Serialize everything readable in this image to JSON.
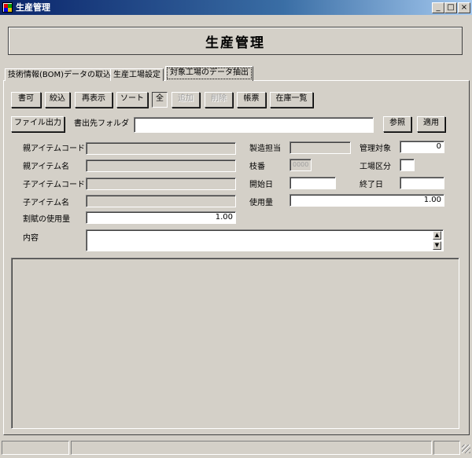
{
  "window": {
    "title": "生産管理",
    "minimize": "_",
    "maximize": "□",
    "close": "×"
  },
  "header": {
    "title": "生産管理"
  },
  "tabs": [
    {
      "label": "技術情報(BOM)データの取込"
    },
    {
      "label": "生産工場設定"
    },
    {
      "label": "対象工場のデータ抽出"
    }
  ],
  "toolbar": {
    "btn_write": "書可",
    "btn_filter": "絞込",
    "btn_refresh": "再表示",
    "btn_sort": "ソート",
    "btn_all": "全",
    "btn_add": "追加",
    "btn_delete": "削除",
    "btn_report": "帳票",
    "btn_inventory": "在庫一覧"
  },
  "export": {
    "file_output": "ファイル出力",
    "folder_label": "書出先フォルダ",
    "folder_value": "",
    "browse": "参照",
    "apply": "適用"
  },
  "form": {
    "parent_code_label": "親アイテムコード",
    "parent_name_label": "親アイテム名",
    "child_code_label": "子アイテムコード",
    "child_name_label": "子アイテム名",
    "alloc_usage_label": "割賦の使用量",
    "alloc_usage_value": "1.00",
    "content_label": "内容",
    "maker_label": "製造担当",
    "branch_label": "枝番",
    "branch_value": "0000",
    "start_label": "開始日",
    "usage_label": "使用量",
    "usage_value": "1.00",
    "managed_label": "管理対象",
    "managed_value": "0",
    "factory_label": "工場区分",
    "end_label": "終了日"
  },
  "colors": {
    "titlebar_start": "#0a246a",
    "face": "#d4d0c8"
  }
}
